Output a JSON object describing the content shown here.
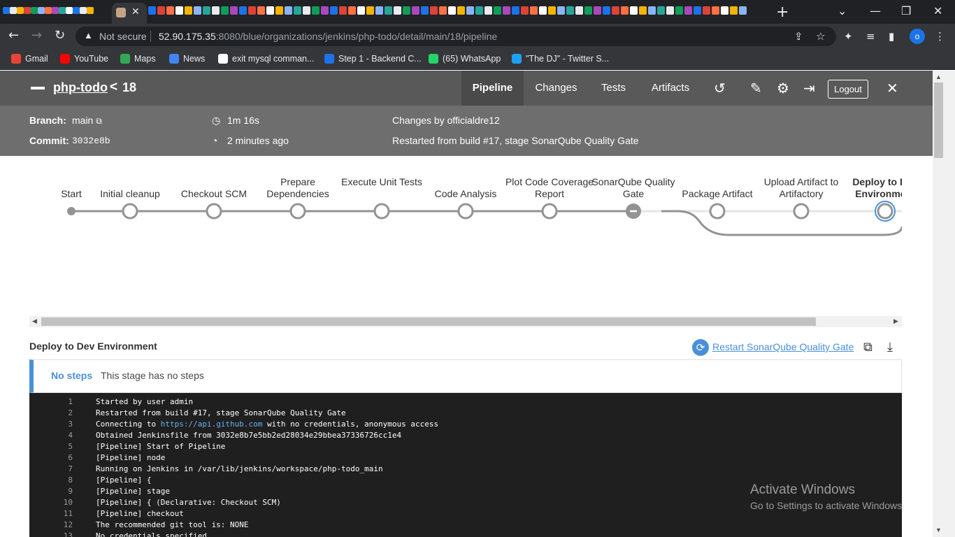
{
  "browser": {
    "active_tab_close": "✕",
    "new_tab": "+",
    "window_controls": {
      "dropdown": "⌄",
      "minimize": "—",
      "restore": "❐",
      "close": "✕"
    },
    "omnibox": {
      "security_label": "Not secure",
      "url_host": "52.90.175.35",
      "url_rest": ":8080/blue/organizations/jenkins/php-todo/detail/main/18/pipeline"
    },
    "profile_initial": "o",
    "bookmarks": [
      {
        "label": "Gmail",
        "icon": "gmail-icon",
        "color": "#ea4335"
      },
      {
        "label": "YouTube",
        "icon": "youtube-icon",
        "color": "#ff0000"
      },
      {
        "label": "Maps",
        "icon": "maps-icon",
        "color": "#34a853"
      },
      {
        "label": "News",
        "icon": "news-icon",
        "color": "#4285f4"
      },
      {
        "label": "exit mysql comman...",
        "icon": "google-icon",
        "color": "#ffffff"
      },
      {
        "label": "Step 1 - Backend C...",
        "icon": "darey-icon",
        "color": "#1a73e8"
      },
      {
        "label": "(65) WhatsApp",
        "icon": "whatsapp-icon",
        "color": "#25d366"
      },
      {
        "label": "\"The DJ\" - Twitter S...",
        "icon": "twitter-icon",
        "color": "#1da1f2"
      }
    ]
  },
  "jenkins": {
    "header": {
      "job_name": "php-todo",
      "separator": "<",
      "run_number": "18",
      "tabs": [
        "Pipeline",
        "Changes",
        "Tests",
        "Artifacts"
      ],
      "active_tab": "Pipeline",
      "logout_label": "Logout",
      "close_symbol": "✕"
    },
    "summary": {
      "branch_label": "Branch:",
      "branch_value": "main",
      "commit_label": "Commit:",
      "commit_value": "3032e8b",
      "duration": "1m 16s",
      "time_ago": "2 minutes ago",
      "changes_by": "Changes by officialdre12",
      "cause": "Restarted from build #17, stage SonarQube Quality Gate"
    },
    "pipeline": {
      "stages": [
        {
          "name": "Start",
          "state": "start"
        },
        {
          "name": "Initial cleanup",
          "state": "not-built"
        },
        {
          "name": "Checkout SCM",
          "state": "not-built"
        },
        {
          "name": "Prepare Dependencies",
          "state": "not-built"
        },
        {
          "name": "Execute Unit Tests",
          "state": "not-built"
        },
        {
          "name": "Code Analysis",
          "state": "not-built"
        },
        {
          "name": "Plot Code Coverage Report",
          "state": "not-built"
        },
        {
          "name": "SonarQube Quality Gate",
          "state": "aborted"
        },
        {
          "name": "Package Artifact",
          "state": "not-built"
        },
        {
          "name": "Upload Artifact to Artifactory",
          "state": "not-built"
        },
        {
          "name": "Deploy to Dev Environment",
          "state": "selected"
        }
      ]
    },
    "stage_detail": {
      "title": "Deploy to Dev Environment",
      "restart_link": "Restart SonarQube Quality Gate",
      "no_steps_label": "No steps",
      "no_steps_message": "This stage has no steps"
    },
    "console": [
      {
        "n": "1",
        "text": "Started by user admin"
      },
      {
        "n": "2",
        "text": "Restarted from build #17, stage SonarQube Quality Gate"
      },
      {
        "n": "3",
        "pre": "Connecting to ",
        "link": "https://api.github.com",
        "post": " with no credentials, anonymous access"
      },
      {
        "n": "4",
        "text": "Obtained Jenkinsfile from 3032e8b7e5bb2ed28034e29bbea37336726cc1e4"
      },
      {
        "n": "5",
        "text": "[Pipeline] Start of Pipeline"
      },
      {
        "n": "6",
        "text": "[Pipeline] node"
      },
      {
        "n": "7",
        "text": "Running on Jenkins in /var/lib/jenkins/workspace/php-todo_main"
      },
      {
        "n": "8",
        "text": "[Pipeline] {"
      },
      {
        "n": "9",
        "text": "[Pipeline] stage"
      },
      {
        "n": "10",
        "text": "[Pipeline] { (Declarative: Checkout SCM)"
      },
      {
        "n": "11",
        "text": "[Pipeline] checkout"
      },
      {
        "n": "12",
        "text": "The recommended git tool is: NONE"
      },
      {
        "n": "13",
        "text": "No credentials specified"
      }
    ]
  },
  "os_watermark": {
    "title": "Activate Windows",
    "subtitle": "Go to Settings to activate Windows."
  }
}
